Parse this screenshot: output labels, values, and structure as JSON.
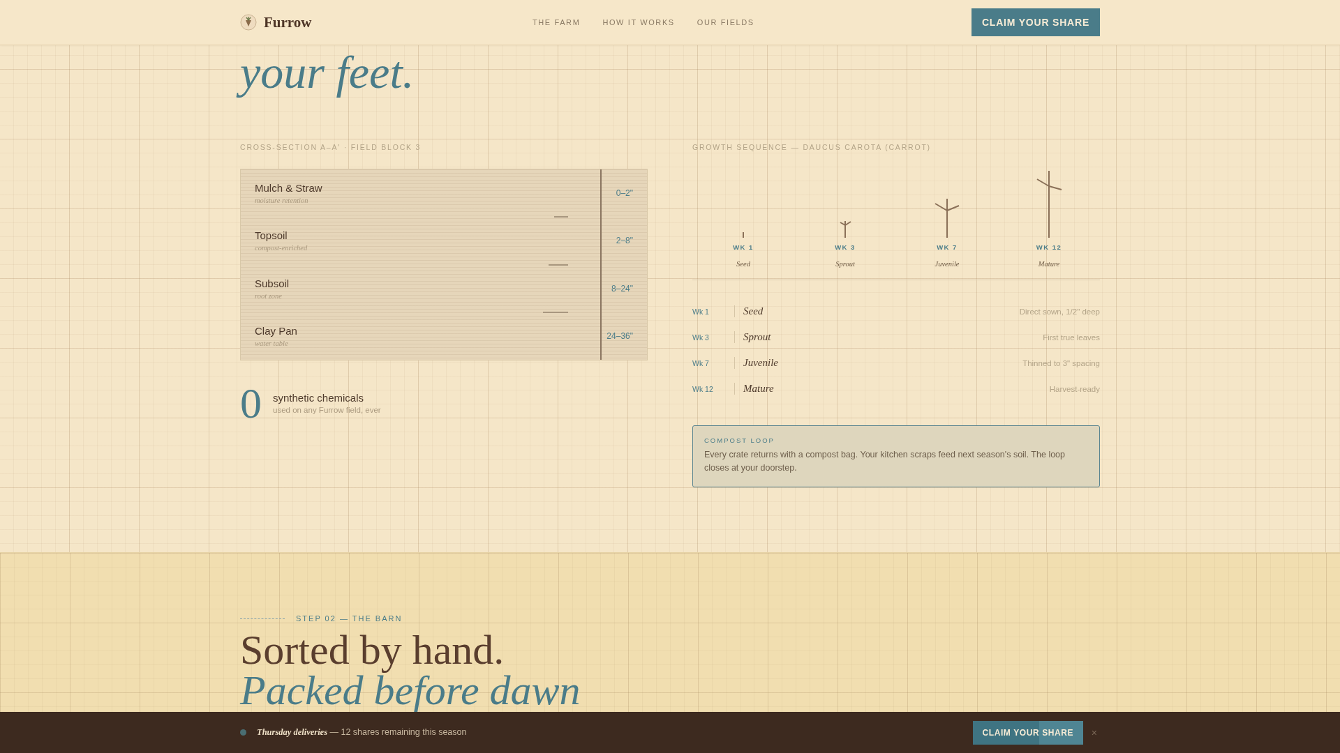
{
  "header": {
    "brand": "Furrow",
    "nav": [
      "THE FARM",
      "HOW IT WORKS",
      "OUR FIELDS"
    ],
    "cta": "CLAIM YOUR SHARE"
  },
  "hero": {
    "line_2": "your feet."
  },
  "cross_section": {
    "label": "CROSS-SECTION A–A′ · FIELD BLOCK 3",
    "layers": [
      {
        "name": "Mulch & Straw",
        "note": "moisture retention",
        "depth": "0–2\""
      },
      {
        "name": "Topsoil",
        "note": "compost-enriched",
        "depth": "2–8\""
      },
      {
        "name": "Subsoil",
        "note": "root zone",
        "depth": "8–24\""
      },
      {
        "name": "Clay Pan",
        "note": "water table",
        "depth": "24–36\""
      }
    ]
  },
  "stat": {
    "value": "0",
    "title": "synthetic chemicals",
    "note": "used on any Furrow field, ever"
  },
  "growth": {
    "label": "GROWTH SEQUENCE — DAUCUS CAROTA (CARROT)",
    "stages": [
      {
        "week": "WK 1",
        "name": "Seed"
      },
      {
        "week": "WK 3",
        "name": "Sprout"
      },
      {
        "week": "WK 7",
        "name": "Juvenile"
      },
      {
        "week": "WK 12",
        "name": "Mature"
      }
    ],
    "rows": [
      {
        "week": "Wk 1",
        "name": "Seed",
        "note": "Direct sown, 1/2\" deep"
      },
      {
        "week": "Wk 3",
        "name": "Sprout",
        "note": "First true leaves"
      },
      {
        "week": "Wk 7",
        "name": "Juvenile",
        "note": "Thinned to 3\" spacing"
      },
      {
        "week": "Wk 12",
        "name": "Mature",
        "note": "Harvest-ready"
      }
    ]
  },
  "compost": {
    "title": "COMPOST LOOP",
    "text": "Every crate returns with a compost bag. Your kitchen scraps feed next season's soil. The loop closes at your doorstep."
  },
  "barn": {
    "step": "STEP 02 — THE BARN",
    "line_1": "Sorted by hand.",
    "line_2": "Packed before dawn"
  },
  "bottom_bar": {
    "text": "*Thursday deliveries* — 12 shares remaining this season",
    "cta": "CLAIM YOUR SHARE",
    "close": "×"
  }
}
